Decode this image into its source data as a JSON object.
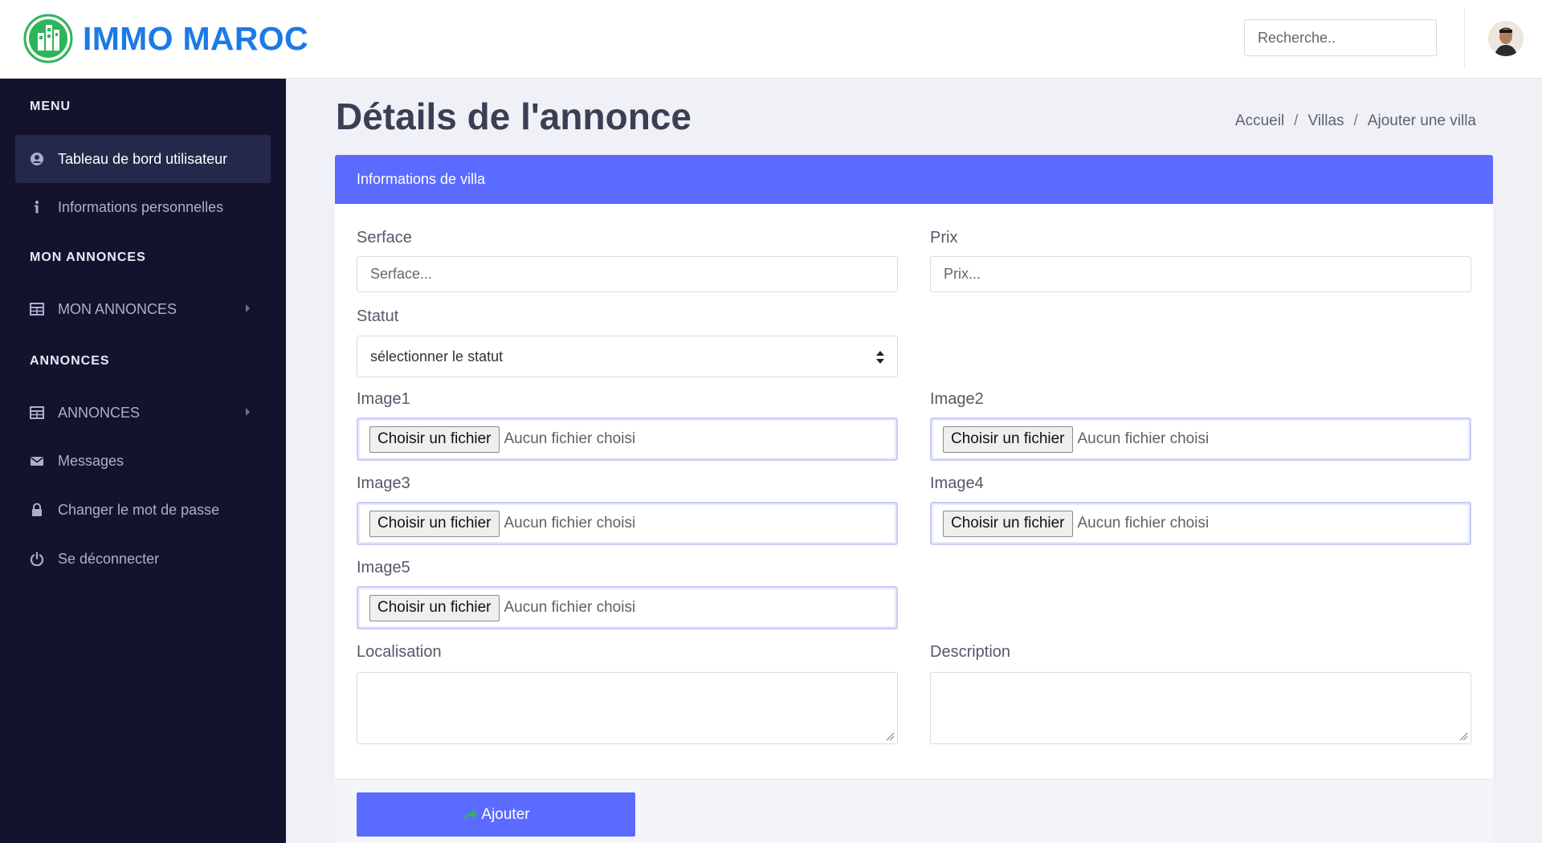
{
  "header": {
    "brand": "IMMO MAROC",
    "logo_icon": "building-logo-icon",
    "search_placeholder": "Recherche..",
    "brand_color": "#1b7ae6"
  },
  "sidebar": {
    "section_menu": "MENU",
    "dashboard": "Tableau de bord utilisateur",
    "personal_info": "Informations personnelles",
    "section_my_ads": "MON ANNONCES",
    "my_ads": "MON ANNONCES",
    "section_ads": "ANNONCES",
    "ads": "ANNONCES",
    "messages": "Messages",
    "change_password": "Changer le mot de passe",
    "logout": "Se déconnecter"
  },
  "page": {
    "title": "Détails de l'annonce",
    "breadcrumb": [
      "Accueil",
      "Villas",
      "Ajouter une villa"
    ],
    "breadcrumb_sep": "/"
  },
  "form": {
    "card_title": "Informations de villa",
    "surface_label": "Serface",
    "surface_placeholder": "Serface...",
    "price_label": "Prix",
    "price_placeholder": "Prix...",
    "status_label": "Statut",
    "status_value": "sélectionner le statut",
    "file_button": "Choisir un fichier",
    "file_status": "Aucun fichier choisi",
    "image1_label": "Image1",
    "image2_label": "Image2",
    "image3_label": "Image3",
    "image4_label": "Image4",
    "image5_label": "Image5",
    "location_label": "Localisation",
    "description_label": "Description",
    "submit_label": "Ajouter"
  },
  "colors": {
    "accent": "#5b6bff",
    "sidebar_bg": "#13132e",
    "page_bg": "#f0f1f7"
  }
}
